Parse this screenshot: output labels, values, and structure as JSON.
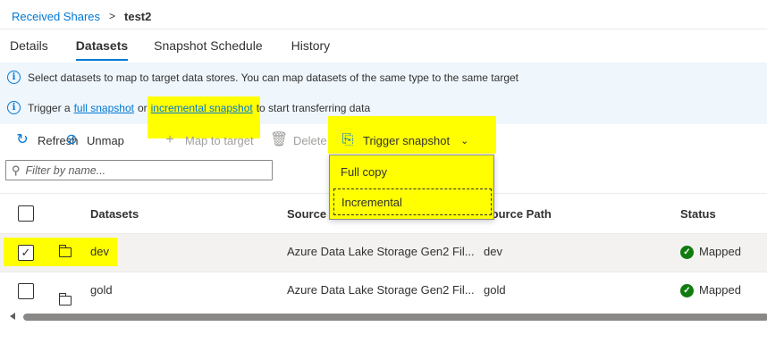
{
  "breadcrumb": {
    "parent": "Received Shares",
    "separator": ">",
    "current": "test2"
  },
  "tabs": [
    {
      "label": "Details"
    },
    {
      "label": "Datasets",
      "active": true
    },
    {
      "label": "Snapshot Schedule"
    },
    {
      "label": "History"
    }
  ],
  "info": {
    "line1": "Select datasets to map to target data stores. You can map datasets of the same type to the same target",
    "line2_prefix": "Trigger a",
    "line2_link1": "full snapshot",
    "line2_or": "or",
    "line2_link2": "incremental snapshot",
    "line2_suffix": "to start transferring data"
  },
  "toolbar": {
    "refresh": "Refresh",
    "unmap": "Unmap",
    "map_to_target": "Map to target",
    "delete": "Delete",
    "trigger_snapshot": "Trigger snapshot"
  },
  "filter": {
    "placeholder": "Filter by name..."
  },
  "table": {
    "headers": {
      "datasets": "Datasets",
      "source_type": "Source T",
      "source_path": "Source Path",
      "status": "Status"
    },
    "rows": [
      {
        "name": "dev",
        "source_type": "Azure Data Lake Storage Gen2 Fil...",
        "source_path": "dev",
        "status": "Mapped",
        "selected": true
      },
      {
        "name": "gold",
        "source_type": "Azure Data Lake Storage Gen2 Fil...",
        "source_path": "gold",
        "status": "Mapped",
        "selected": false
      }
    ]
  },
  "dropdown": {
    "items": [
      "Full copy",
      "Incremental"
    ]
  },
  "colors": {
    "accent": "#0078d4",
    "highlight": "#ffff00",
    "mapped": "#107c10",
    "info_bg": "#eff6fc"
  }
}
